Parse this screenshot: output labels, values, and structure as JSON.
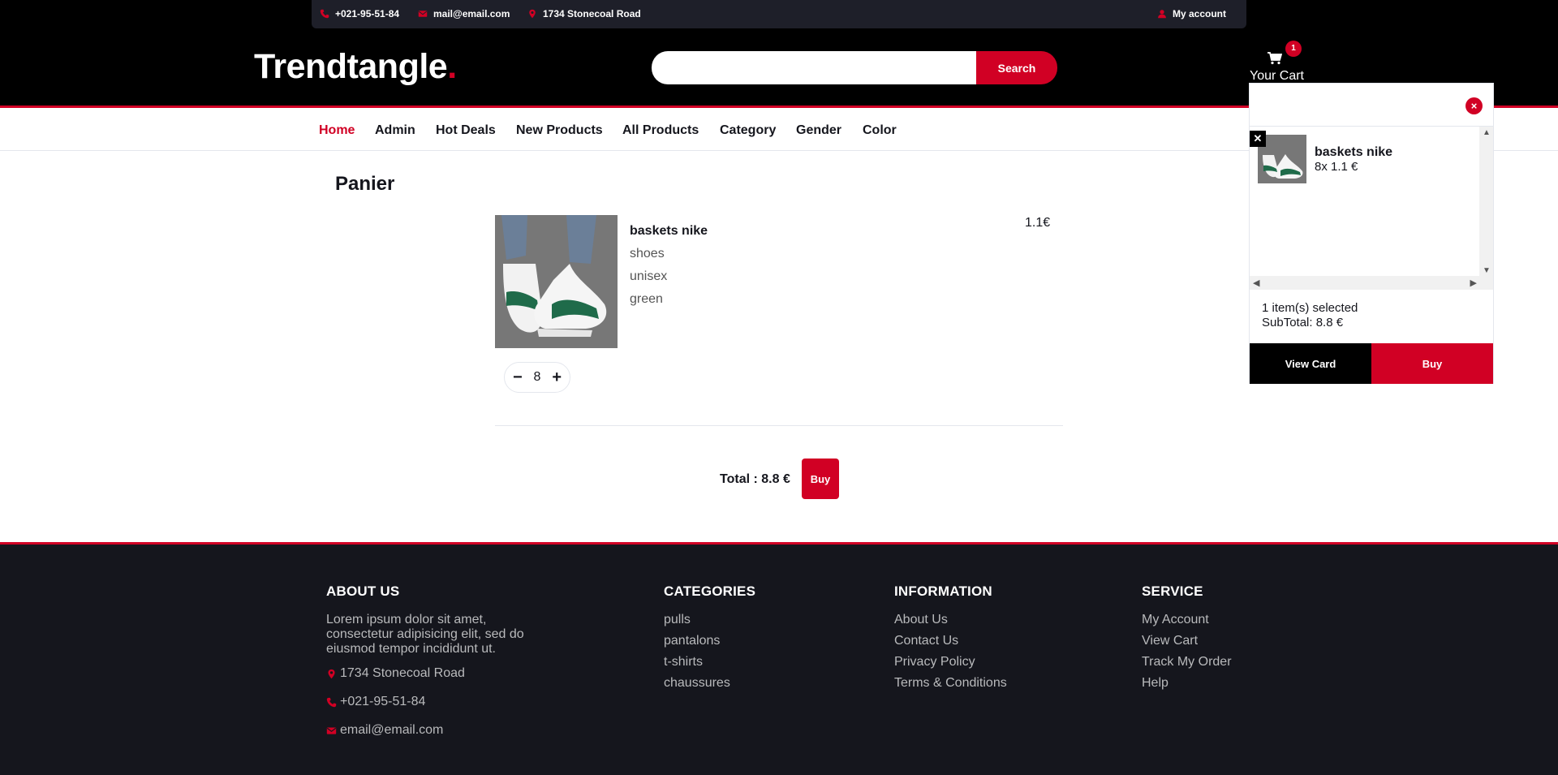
{
  "top_strip": {
    "phone": "+021-95-51-84",
    "email": "mail@email.com",
    "address": "1734 Stonecoal Road",
    "account": "My account"
  },
  "header": {
    "logo": "Trendtangle",
    "logo_dot": ".",
    "search_placeholder": "",
    "search_button": "Search",
    "cart_label": "Your Cart",
    "cart_count": "1"
  },
  "nav": {
    "items": [
      "Home",
      "Admin",
      "Hot Deals",
      "New Products",
      "All Products",
      "Category",
      "Gender",
      "Color"
    ]
  },
  "main": {
    "title": "Panier",
    "product": {
      "name": "baskets nike",
      "category": "shoes",
      "gender": "unisex",
      "color": "green",
      "price": "1.1€",
      "quantity": "8",
      "minus": "−",
      "plus": "+"
    },
    "total": "Total : 8.8 €",
    "buy": "Buy"
  },
  "cart_dropdown": {
    "close": "×",
    "remove": "✕",
    "item_name": "baskets nike",
    "item_qty": "8x 1.1 €",
    "selected": "1 item(s) selected",
    "subtotal": "SubTotal: 8.8 €",
    "view_card": "View Card",
    "buy": "Buy"
  },
  "footer": {
    "about": {
      "title": "ABOUT US",
      "text": "Lorem ipsum dolor sit amet, consectetur adipisicing elit, sed do eiusmod tempor incididunt ut.",
      "address": "1734 Stonecoal Road",
      "phone": "+021-95-51-84",
      "email": "email@email.com"
    },
    "categories": {
      "title": "CATEGORIES",
      "items": [
        "pulls",
        "pantalons",
        "t-shirts",
        "chaussures"
      ]
    },
    "information": {
      "title": "INFORMATION",
      "items": [
        "About Us",
        "Contact Us",
        "Privacy Policy",
        "Terms & Conditions"
      ]
    },
    "service": {
      "title": "SERVICE",
      "items": [
        "My Account",
        "View Cart",
        "Track My Order",
        "Help"
      ]
    }
  },
  "colors": {
    "accent": "#d10024",
    "dark": "#15161d",
    "strip": "#1e1f29"
  }
}
